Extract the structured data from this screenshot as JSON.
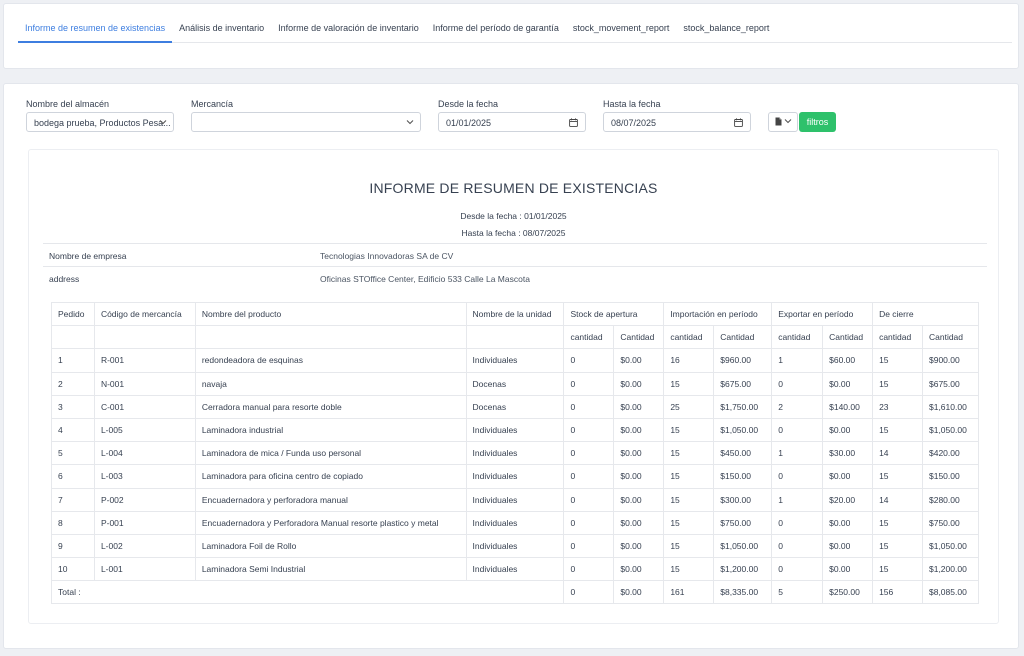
{
  "tabs": [
    {
      "label": "Informe de resumen de existencias",
      "active": true
    },
    {
      "label": "Análisis de inventario"
    },
    {
      "label": "Informe de valoración de inventario"
    },
    {
      "label": "Informe del período de garantía"
    },
    {
      "label": "stock_movement_report"
    },
    {
      "label": "stock_balance_report"
    }
  ],
  "filters": {
    "warehouse_label": "Nombre del almacén",
    "warehouse_value": "bodega prueba, Productos Pesa...",
    "product_label": "Mercancía",
    "product_value": "",
    "from_label": "Desde la fecha",
    "from_value": "01/01/2025",
    "to_label": "Hasta la fecha",
    "to_value": "08/07/2025",
    "filter_button": "filtros"
  },
  "report": {
    "title": "INFORME DE RESUMEN DE EXISTENCIAS",
    "from_line": "Desde la fecha : 01/01/2025",
    "to_line": "Hasta la fecha : 08/07/2025",
    "company_label": "Nombre de empresa",
    "company_value": "Tecnologias Innovadoras SA de CV",
    "address_label": "address",
    "address_value": "Oficinas STOffice Center, Edificio 533 Calle La Mascota"
  },
  "table": {
    "headers": {
      "order": "Pedido",
      "code": "Código de mercancía",
      "product": "Nombre del producto",
      "unit": "Nombre de la unidad",
      "opening": "Stock de apertura",
      "import": "Importación en período",
      "export": "Exportar en período",
      "closing": "De cierre"
    },
    "sub_headers": [
      "cantidad",
      "Cantidad",
      "cantidad",
      "Cantidad",
      "cantidad",
      "Cantidad",
      "cantidad",
      "Cantidad"
    ],
    "rows": [
      [
        "1",
        "R-001",
        "redondeadora de esquinas",
        "Individuales",
        "0",
        "$0.00",
        "16",
        "$960.00",
        "1",
        "$60.00",
        "15",
        "$900.00"
      ],
      [
        "2",
        "N-001",
        "navaja",
        "Docenas",
        "0",
        "$0.00",
        "15",
        "$675.00",
        "0",
        "$0.00",
        "15",
        "$675.00"
      ],
      [
        "3",
        "C-001",
        "Cerradora manual para resorte doble",
        "Docenas",
        "0",
        "$0.00",
        "25",
        "$1,750.00",
        "2",
        "$140.00",
        "23",
        "$1,610.00"
      ],
      [
        "4",
        "L-005",
        "Laminadora industrial",
        "Individuales",
        "0",
        "$0.00",
        "15",
        "$1,050.00",
        "0",
        "$0.00",
        "15",
        "$1,050.00"
      ],
      [
        "5",
        "L-004",
        "Laminadora de mica / Funda uso personal",
        "Individuales",
        "0",
        "$0.00",
        "15",
        "$450.00",
        "1",
        "$30.00",
        "14",
        "$420.00"
      ],
      [
        "6",
        "L-003",
        "Laminadora para oficina centro de copiado",
        "Individuales",
        "0",
        "$0.00",
        "15",
        "$150.00",
        "0",
        "$0.00",
        "15",
        "$150.00"
      ],
      [
        "7",
        "P-002",
        "Encuadernadora y perforadora manual",
        "Individuales",
        "0",
        "$0.00",
        "15",
        "$300.00",
        "1",
        "$20.00",
        "14",
        "$280.00"
      ],
      [
        "8",
        "P-001",
        "Encuadernadora y Perforadora Manual resorte plastico y metal",
        "Individuales",
        "0",
        "$0.00",
        "15",
        "$750.00",
        "0",
        "$0.00",
        "15",
        "$750.00"
      ],
      [
        "9",
        "L-002",
        "Laminadora Foil de Rollo",
        "Individuales",
        "0",
        "$0.00",
        "15",
        "$1,050.00",
        "0",
        "$0.00",
        "15",
        "$1,050.00"
      ],
      [
        "10",
        "L-001",
        "Laminadora Semi Industrial",
        "Individuales",
        "0",
        "$0.00",
        "15",
        "$1,200.00",
        "0",
        "$0.00",
        "15",
        "$1,200.00"
      ]
    ],
    "total_label": "Total :",
    "totals": [
      "0",
      "$0.00",
      "161",
      "$8,335.00",
      "5",
      "$250.00",
      "156",
      "$8,085.00"
    ]
  }
}
